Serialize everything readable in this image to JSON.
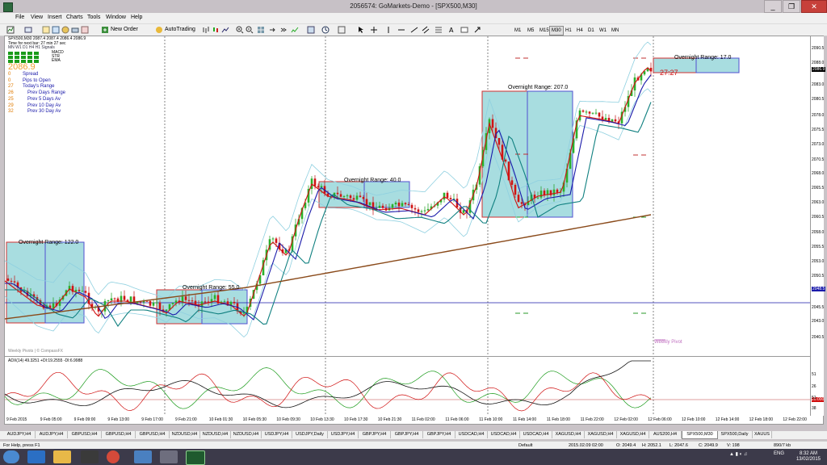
{
  "window": {
    "title": "2056574: GoMarkets-Demo - [SPX500,M30]",
    "min": "_",
    "max": "❐",
    "close": "✕"
  },
  "menu": [
    "File",
    "View",
    "Insert",
    "Charts",
    "Tools",
    "Window",
    "Help"
  ],
  "toolbar": {
    "new_order": "New Order",
    "autotrading": "AutoTrading",
    "timeframes": [
      "M1",
      "M5",
      "M15",
      "M30",
      "H1",
      "H4",
      "D1",
      "W1",
      "MN"
    ],
    "active_timeframe": "M30"
  },
  "chart": {
    "info_line1": "SPX500,M30  2087.4 2087.4 2086.4 2086.9",
    "info_line2": "Time for next bar: 27 min 27 sec",
    "signals_header": "MN  W1  D1  H4  H1  Signals",
    "signals": [
      "MACD",
      "STR",
      "EMA"
    ],
    "bid": "2086.9",
    "stats": [
      {
        "n": "0",
        "label": "Spread"
      },
      {
        "n": "0",
        "label": "Pips to Open"
      },
      {
        "n": "27",
        "label": "Today's Range"
      },
      {
        "n": "26",
        "label": "Prev Days Range"
      },
      {
        "n": "25",
        "label": "Prev 5 Days Av"
      },
      {
        "n": "29",
        "label": "Prev 10 Day Av"
      },
      {
        "n": "32",
        "label": "Prev 30 Day Av"
      }
    ],
    "ranges": [
      {
        "label": "Overnight Range: 122.0"
      },
      {
        "label": "Overnight Range: 55.0"
      },
      {
        "label": "Overnight Range: 40.0"
      },
      {
        "label": "Overnight Range: 207.0"
      },
      {
        "label": "Overnight Range: 17.0"
      }
    ],
    "countdown": "27:27",
    "weekly_pivot": "Weekly Pivot",
    "watermark": "Weekly Pivots | © CompassFX",
    "price_labels": [
      "2090.5",
      "2088.0",
      "2086.9",
      "2083.0",
      "2080.5",
      "2078.0",
      "2075.5",
      "2073.0",
      "2070.5",
      "2068.0",
      "2065.5",
      "2063.0",
      "2060.5",
      "2058.0",
      "2055.5",
      "2053.0",
      "2050.5",
      "2048.5",
      "2045.5",
      "2043.0",
      "2040.5"
    ],
    "pivot_price": "2048.5",
    "adx_label": "ADX(14) 49.3251 +DI:19.2555 -DI:6.9988",
    "adx_axis": [
      "51",
      "38",
      "26",
      "14"
    ],
    "adx_level": "20.000",
    "time_labels": [
      "9 Feb 2015",
      "9 Feb 05:00",
      "9 Feb 09:00",
      "9 Feb 13:00",
      "9 Feb 17:00",
      "9 Feb 21:00",
      "10 Feb 01:30",
      "10 Feb 05:30",
      "10 Feb 09:30",
      "10 Feb 13:30",
      "10 Feb 17:30",
      "10 Feb 21:30",
      "11 Feb 02:00",
      "11 Feb 06:00",
      "11 Feb 10:00",
      "11 Feb 14:00",
      "11 Feb 18:00",
      "11 Feb 22:00",
      "12 Feb 02:00",
      "12 Feb 06:00",
      "12 Feb 10:00",
      "12 Feb 14:00",
      "12 Feb 18:00",
      "12 Feb 22:00"
    ]
  },
  "tabs": [
    "AUDJPY,H4",
    "AUDJPY,H4",
    "GBPUSD,H4",
    "GBPUSD,H4",
    "GBPUSD,H4",
    "NZDUSD,H4",
    "NZDUSD,H4",
    "NZDUSD,H4",
    "USDJPY,H4",
    "USDJPY,Daily",
    "USDJPY,H4",
    "GBPJPY,H4",
    "GBPJPY,H4",
    "GBPJPY,H4",
    "USDCAD,H4",
    "USDCAD,H4",
    "USDCAD,H4",
    "XAGUSD,H4",
    "XAGUSD,H4",
    "XAGUSD,H4",
    "AUS200,H4",
    "SPX500,M30",
    "SPX500,Daily",
    "XAUUS"
  ],
  "active_tab": "SPX500,M30",
  "status": {
    "help": "For Help, press F1",
    "profile": "Default",
    "datetime": "2015.02.09 02:00",
    "open": "O: 2049.4",
    "high": "H: 2052.1",
    "low": "L: 2047.6",
    "close": "C: 2049.9",
    "volume": "V: 198",
    "traffic": "890/7 kb"
  },
  "taskbar": {
    "lang": "ENG",
    "time": "8:32 AM",
    "date": "13/02/2015"
  }
}
